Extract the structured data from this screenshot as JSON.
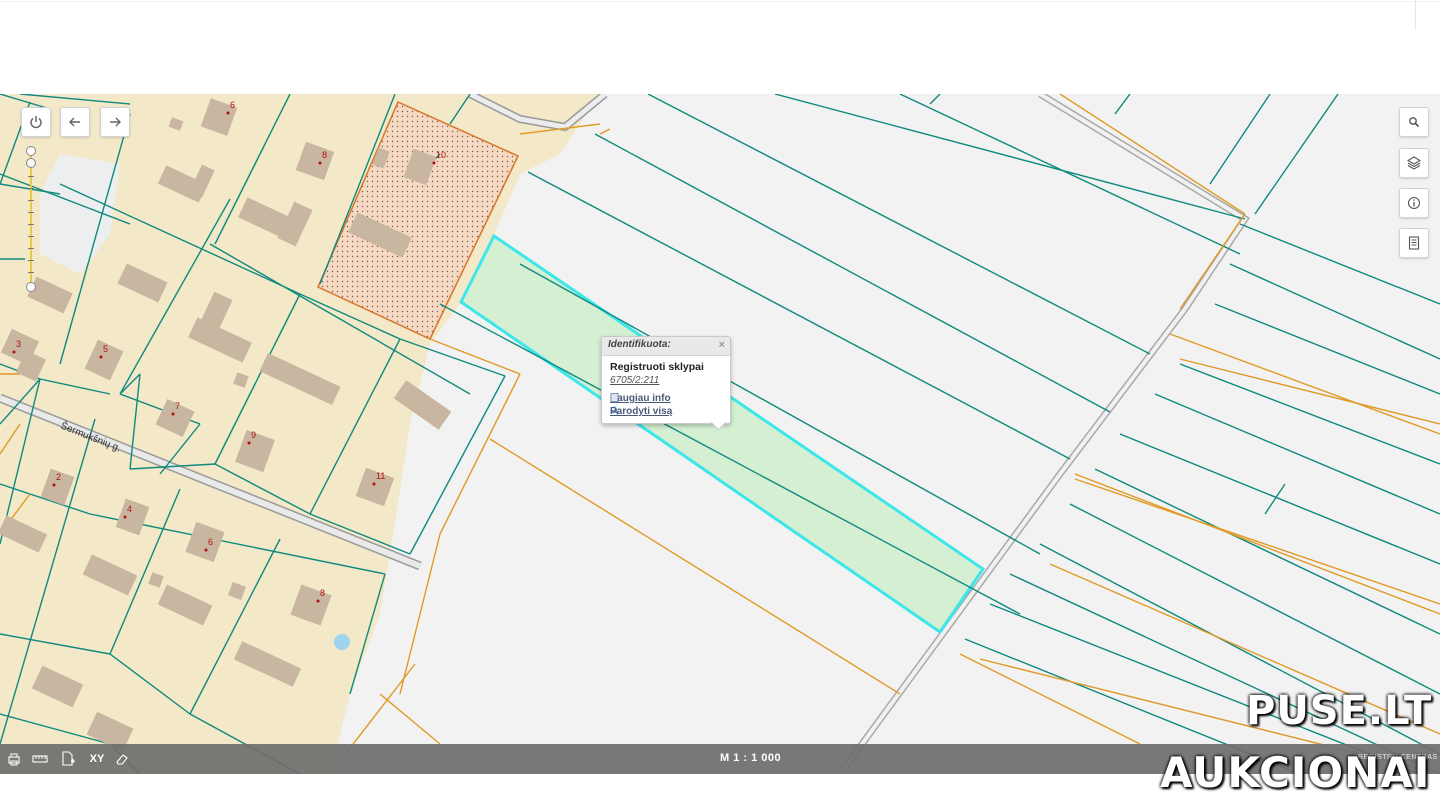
{
  "toolbar": {
    "power_icon": "power-icon",
    "back_icon": "arrow-left-icon",
    "forward_icon": "arrow-right-icon"
  },
  "right_tools": [
    "search-icon",
    "layers-icon",
    "info-icon",
    "document-icon"
  ],
  "map": {
    "street_name": "Šermukšnių g.",
    "house_numbers": [
      "6",
      "8",
      "10",
      "3",
      "5",
      "7",
      "9",
      "11",
      "2",
      "4",
      "6",
      "8"
    ],
    "colors": {
      "residential": "#f3e8c8",
      "parcel_line": "#0f8a7e",
      "orange_line": "#e09a25",
      "selected_fill": "#d5efd2",
      "selected_border": "#3de6ea",
      "hatched_parcel": "#f5d9c3",
      "building": "#c8b6a0"
    }
  },
  "popup": {
    "title": "Identifikuota:",
    "close": "×",
    "layer": "Registruoti sklypai",
    "parcel_id": "6705/2:211",
    "more_info": "Daugiau info",
    "show_all": "Parodyti visą"
  },
  "bottombar": {
    "scale": "M 1 : 1 000",
    "credit": "REGISTRŲ CENTRAS",
    "tools": [
      "print-icon",
      "ruler-icon",
      "add-page-icon",
      "xy-icon",
      "eraser-icon"
    ],
    "xy_label": "XY"
  },
  "watermark": {
    "line1": "PUSE.LT",
    "line2": "AUKCIONAI"
  }
}
